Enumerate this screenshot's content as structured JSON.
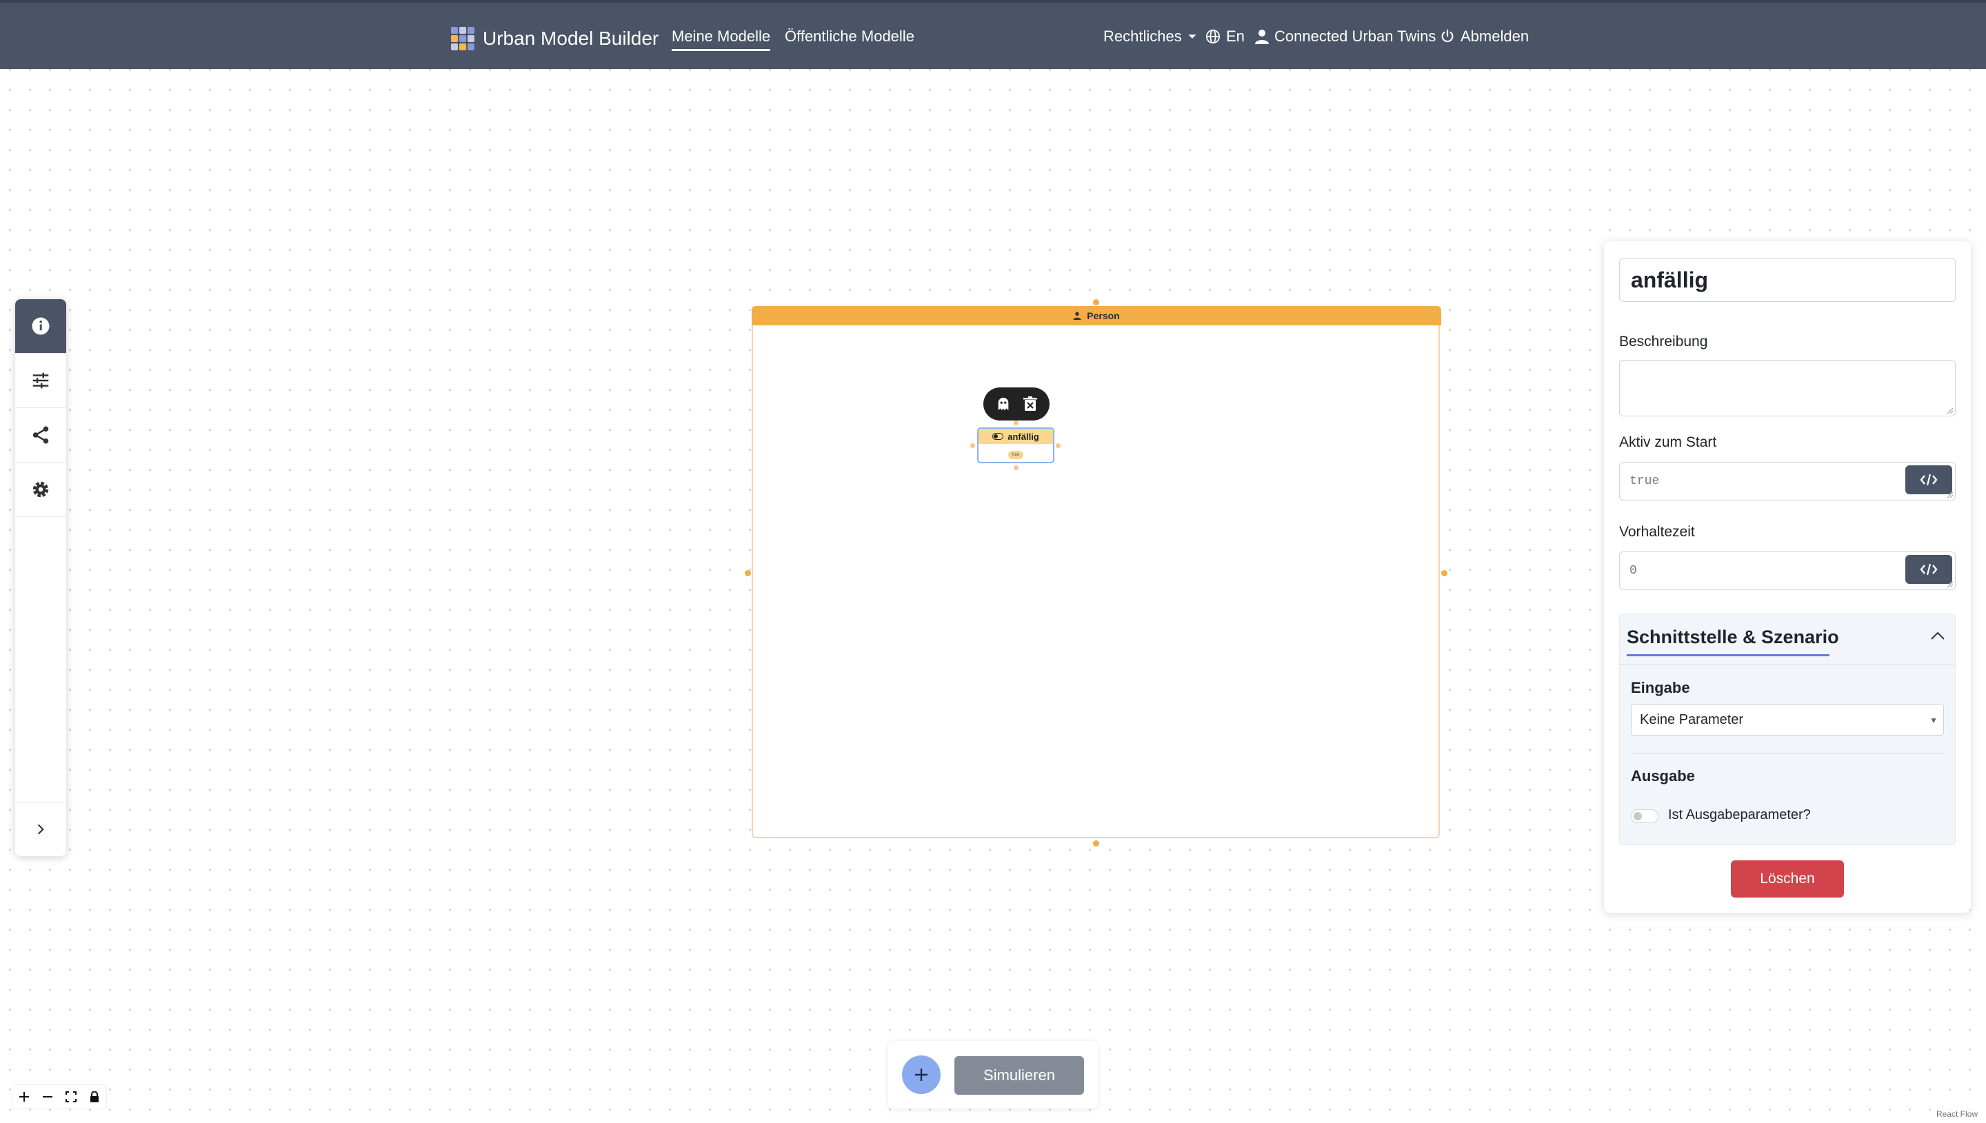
{
  "navbar": {
    "brand": "Urban Model Builder",
    "links": [
      "Meine Modelle",
      "Öffentliche Modelle"
    ],
    "legal": "Rechtliches",
    "language": "En",
    "user": "Connected Urban Twins",
    "logout": "Abmelden"
  },
  "left_toolbar": {
    "items": [
      "info-icon",
      "sliders-icon",
      "share-icon",
      "gear-icon"
    ],
    "toggle": "chevron-right-icon"
  },
  "canvas": {
    "group_node": {
      "label": "Person",
      "icon": "person-icon"
    },
    "state_node": {
      "label": "anfällig",
      "icon": "toggle-icon",
      "badge": "true"
    },
    "node_toolbar": [
      "ghost-icon",
      "delete-icon"
    ]
  },
  "panel": {
    "name_value": "anfällig",
    "description_label": "Beschreibung",
    "description_value": "",
    "active_label": "Aktiv zum Start",
    "active_value": "true",
    "delay_label": "Vorhaltezeit",
    "delay_value": "0",
    "section_title": "Schnittstelle & Szenario",
    "input_label": "Eingabe",
    "input_selected": "Keine Parameter",
    "output_label": "Ausgabe",
    "output_switch_label": "Ist Ausgabeparameter?",
    "output_switch_on": false,
    "delete_label": "Löschen"
  },
  "bottom_bar": {
    "add_icon": "plus-icon",
    "simulate_label": "Simulieren"
  },
  "zoom_controls": [
    "zoom-in-icon",
    "zoom-out-icon",
    "fit-view-icon",
    "lock-icon"
  ],
  "attribution": "React Flow",
  "colors": {
    "navbar": "#4a5466",
    "group_accent": "#f2ad47",
    "state_header": "#f7d88e",
    "delete_button": "#d3434b",
    "add_button": "#8aaaf0",
    "simulate_button": "#858b96"
  }
}
